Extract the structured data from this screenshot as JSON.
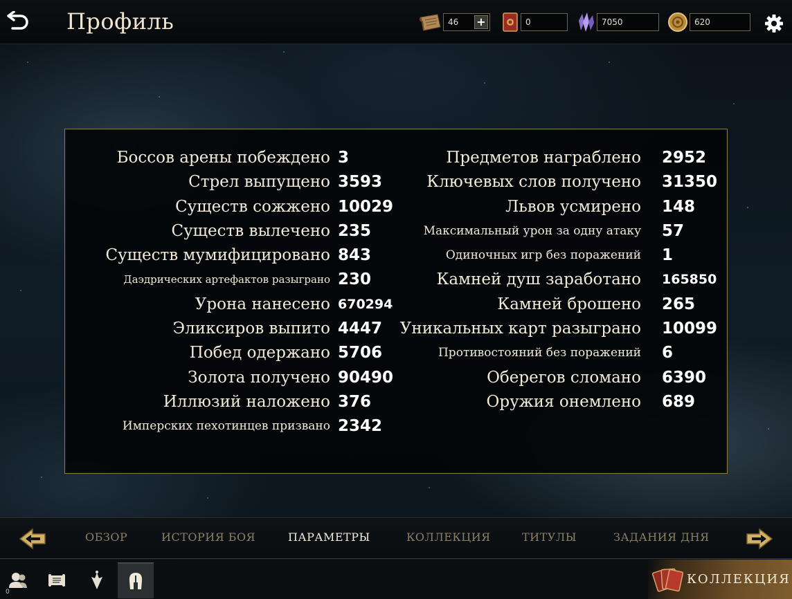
{
  "header": {
    "title": "Профиль",
    "currencies": [
      {
        "name": "scrolls",
        "value": "46",
        "has_plus": true
      },
      {
        "name": "card-packs",
        "value": "0"
      },
      {
        "name": "soul-gems",
        "value": "7050"
      },
      {
        "name": "gold",
        "value": "620"
      }
    ]
  },
  "stats": {
    "left": [
      {
        "label": "Боссов арены побеждено",
        "value": "3"
      },
      {
        "label": "Стрел выпущено",
        "value": "3593"
      },
      {
        "label": "Существ сожжено",
        "value": "10029"
      },
      {
        "label": "Существ вылечено",
        "value": "235"
      },
      {
        "label": "Существ мумифицировано",
        "value": "843"
      },
      {
        "label": "Даэдрических артефактов разыграно",
        "value": "230"
      },
      {
        "label": "Урона нанесено",
        "value": "670294"
      },
      {
        "label": "Эликсиров выпито",
        "value": "4447"
      },
      {
        "label": "Побед одержано",
        "value": "5706"
      },
      {
        "label": "Золота получено",
        "value": "90490"
      },
      {
        "label": "Иллюзий наложено",
        "value": "376"
      },
      {
        "label": "Имперских пехотинцев призвано",
        "value": "2342"
      }
    ],
    "right": [
      {
        "label": "Предметов награблено",
        "value": "2952"
      },
      {
        "label": "Ключевых слов получено",
        "value": "31350"
      },
      {
        "label": "Львов усмирено",
        "value": "148"
      },
      {
        "label": "Максимальный урон за одну атаку",
        "value": "57"
      },
      {
        "label": "Одиночных игр без поражений",
        "value": "1"
      },
      {
        "label": "Камней душ заработано",
        "value": "165850"
      },
      {
        "label": "Камней брошено",
        "value": "265"
      },
      {
        "label": "Уникальных карт разыграно",
        "value": "10099"
      },
      {
        "label": "Противостояний без поражений",
        "value": "6"
      },
      {
        "label": "Оберегов сломано",
        "value": "6390"
      },
      {
        "label": "Оружия онемлено",
        "value": "689"
      }
    ]
  },
  "tabs": [
    {
      "label": "ОБЗОР"
    },
    {
      "label": "ИСТОРИЯ БОЯ"
    },
    {
      "label": "ПАРАМЕТРЫ",
      "active": true
    },
    {
      "label": "КОЛЛЕКЦИЯ"
    },
    {
      "label": "ТИТУЛЫ"
    },
    {
      "label": "ЗАДАНИЯ ДНЯ"
    }
  ],
  "bottom_nav": {
    "friends_badge": "0",
    "collection_label": "КОЛЛЕКЦИЯ"
  },
  "icons": {
    "back": "back-arrow-icon",
    "settings": "gear-icon",
    "tab_prev": "left-arrow-icon",
    "tab_next": "right-arrow-icon"
  },
  "colors": {
    "accent_gold": "#8b7b4a",
    "active_tab": "#f3ecdc",
    "inactive_tab": "#8a8165"
  }
}
